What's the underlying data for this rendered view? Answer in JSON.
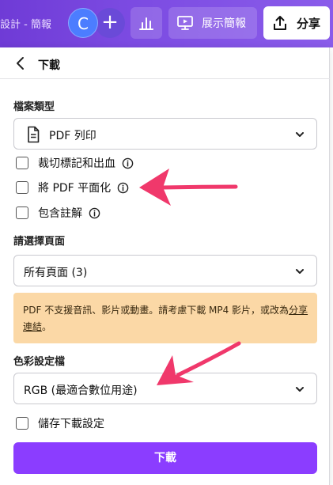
{
  "topbar": {
    "doc_title": "設計 - 簡報",
    "avatar_initial": "C",
    "plus_symbol": "+",
    "present_label": "展示簡報",
    "share_label": "分享"
  },
  "panel": {
    "title": "下載",
    "file_type": {
      "label": "檔案類型",
      "selected": "PDF 列印"
    },
    "options": [
      {
        "label": "裁切標記和出血",
        "checked": false
      },
      {
        "label": "將 PDF 平面化",
        "checked": false
      },
      {
        "label": "包含註解",
        "checked": false
      }
    ],
    "pages": {
      "label": "請選擇頁面",
      "selected": "所有頁面 (3)"
    },
    "notice": {
      "text": "PDF 不支援音訊、影片或動畫。請考慮下載 MP4 影片，或改為",
      "link": "分享連結",
      "end": "。"
    },
    "color_profile": {
      "label": "色彩設定檔",
      "selected": "RGB (最適合數位用途)"
    },
    "save_settings": {
      "label": "儲存下載設定",
      "checked": false
    },
    "download_button": "下載"
  },
  "colors": {
    "topbar": "#7c4be2",
    "primary_button": "#8b3dff",
    "notice_bg": "#fbd8a6",
    "annotation_arrow": "#f0386b"
  },
  "icons": {
    "analytics": "bar-chart-icon",
    "present": "presentation-icon",
    "share": "upload-icon",
    "back": "chevron-left-icon",
    "file": "document-icon",
    "info": "info-icon",
    "dropdown": "chevron-down-icon"
  }
}
